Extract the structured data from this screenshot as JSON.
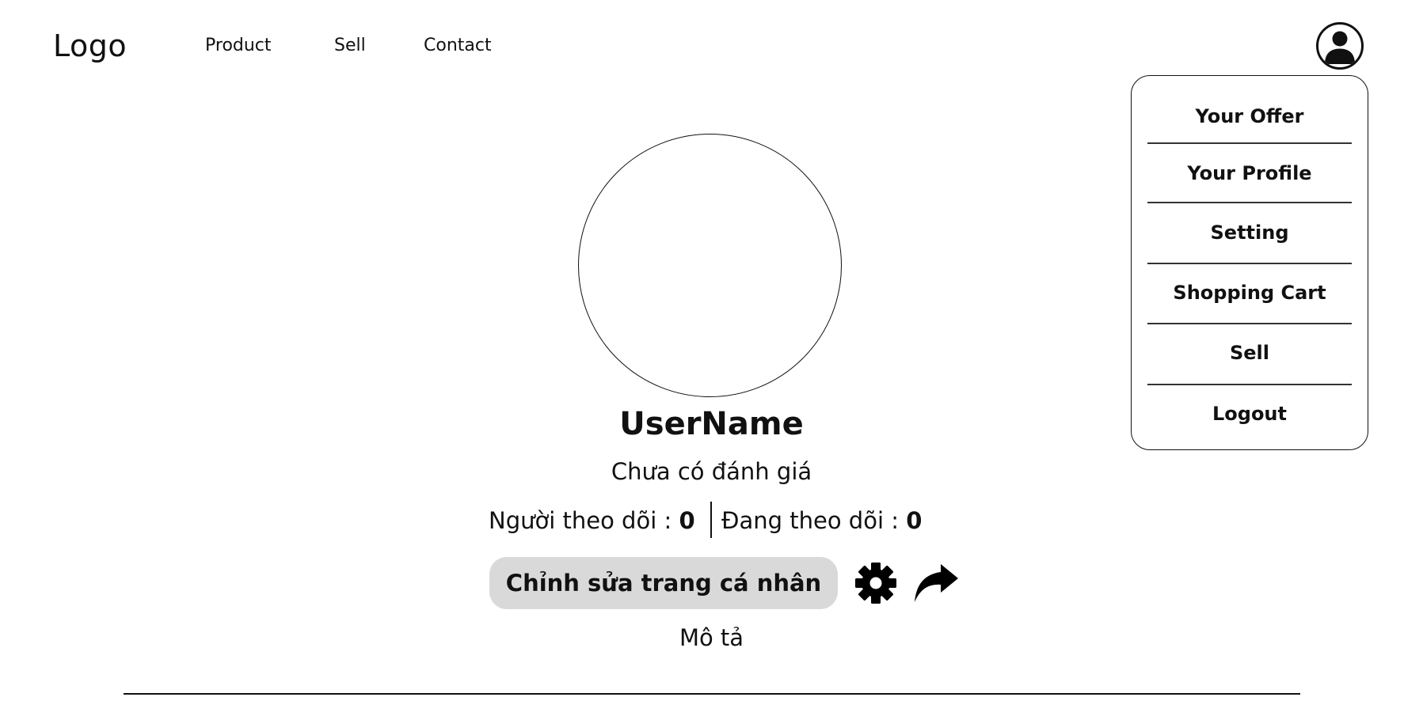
{
  "header": {
    "logo": "Logo",
    "nav": [
      "Product",
      "Sell",
      "Contact"
    ]
  },
  "account_menu": {
    "icon": "user-circle-icon",
    "items": [
      "Your Offer",
      "Your Profile",
      "Setting",
      "Shopping Cart",
      "Sell",
      "Logout"
    ]
  },
  "profile": {
    "photo_icon": "profile-photo-placeholder",
    "username": "UserName",
    "rating_text": "Chưa có đánh giá",
    "followers_label": "Người theo dõi : ",
    "followers_count": "0",
    "following_label": "Đang theo dõi : ",
    "following_count": "0",
    "edit_button": "Chỉnh sửa trang cá nhân",
    "settings_icon": "gear-icon",
    "share_icon": "share-arrow-icon",
    "description": "Mô tả"
  },
  "colors": {
    "text": "#111111",
    "edit_button_bg": "#d9d9d9",
    "active_tab_bg": "#000000",
    "active_tab_text": "#ffffff"
  }
}
